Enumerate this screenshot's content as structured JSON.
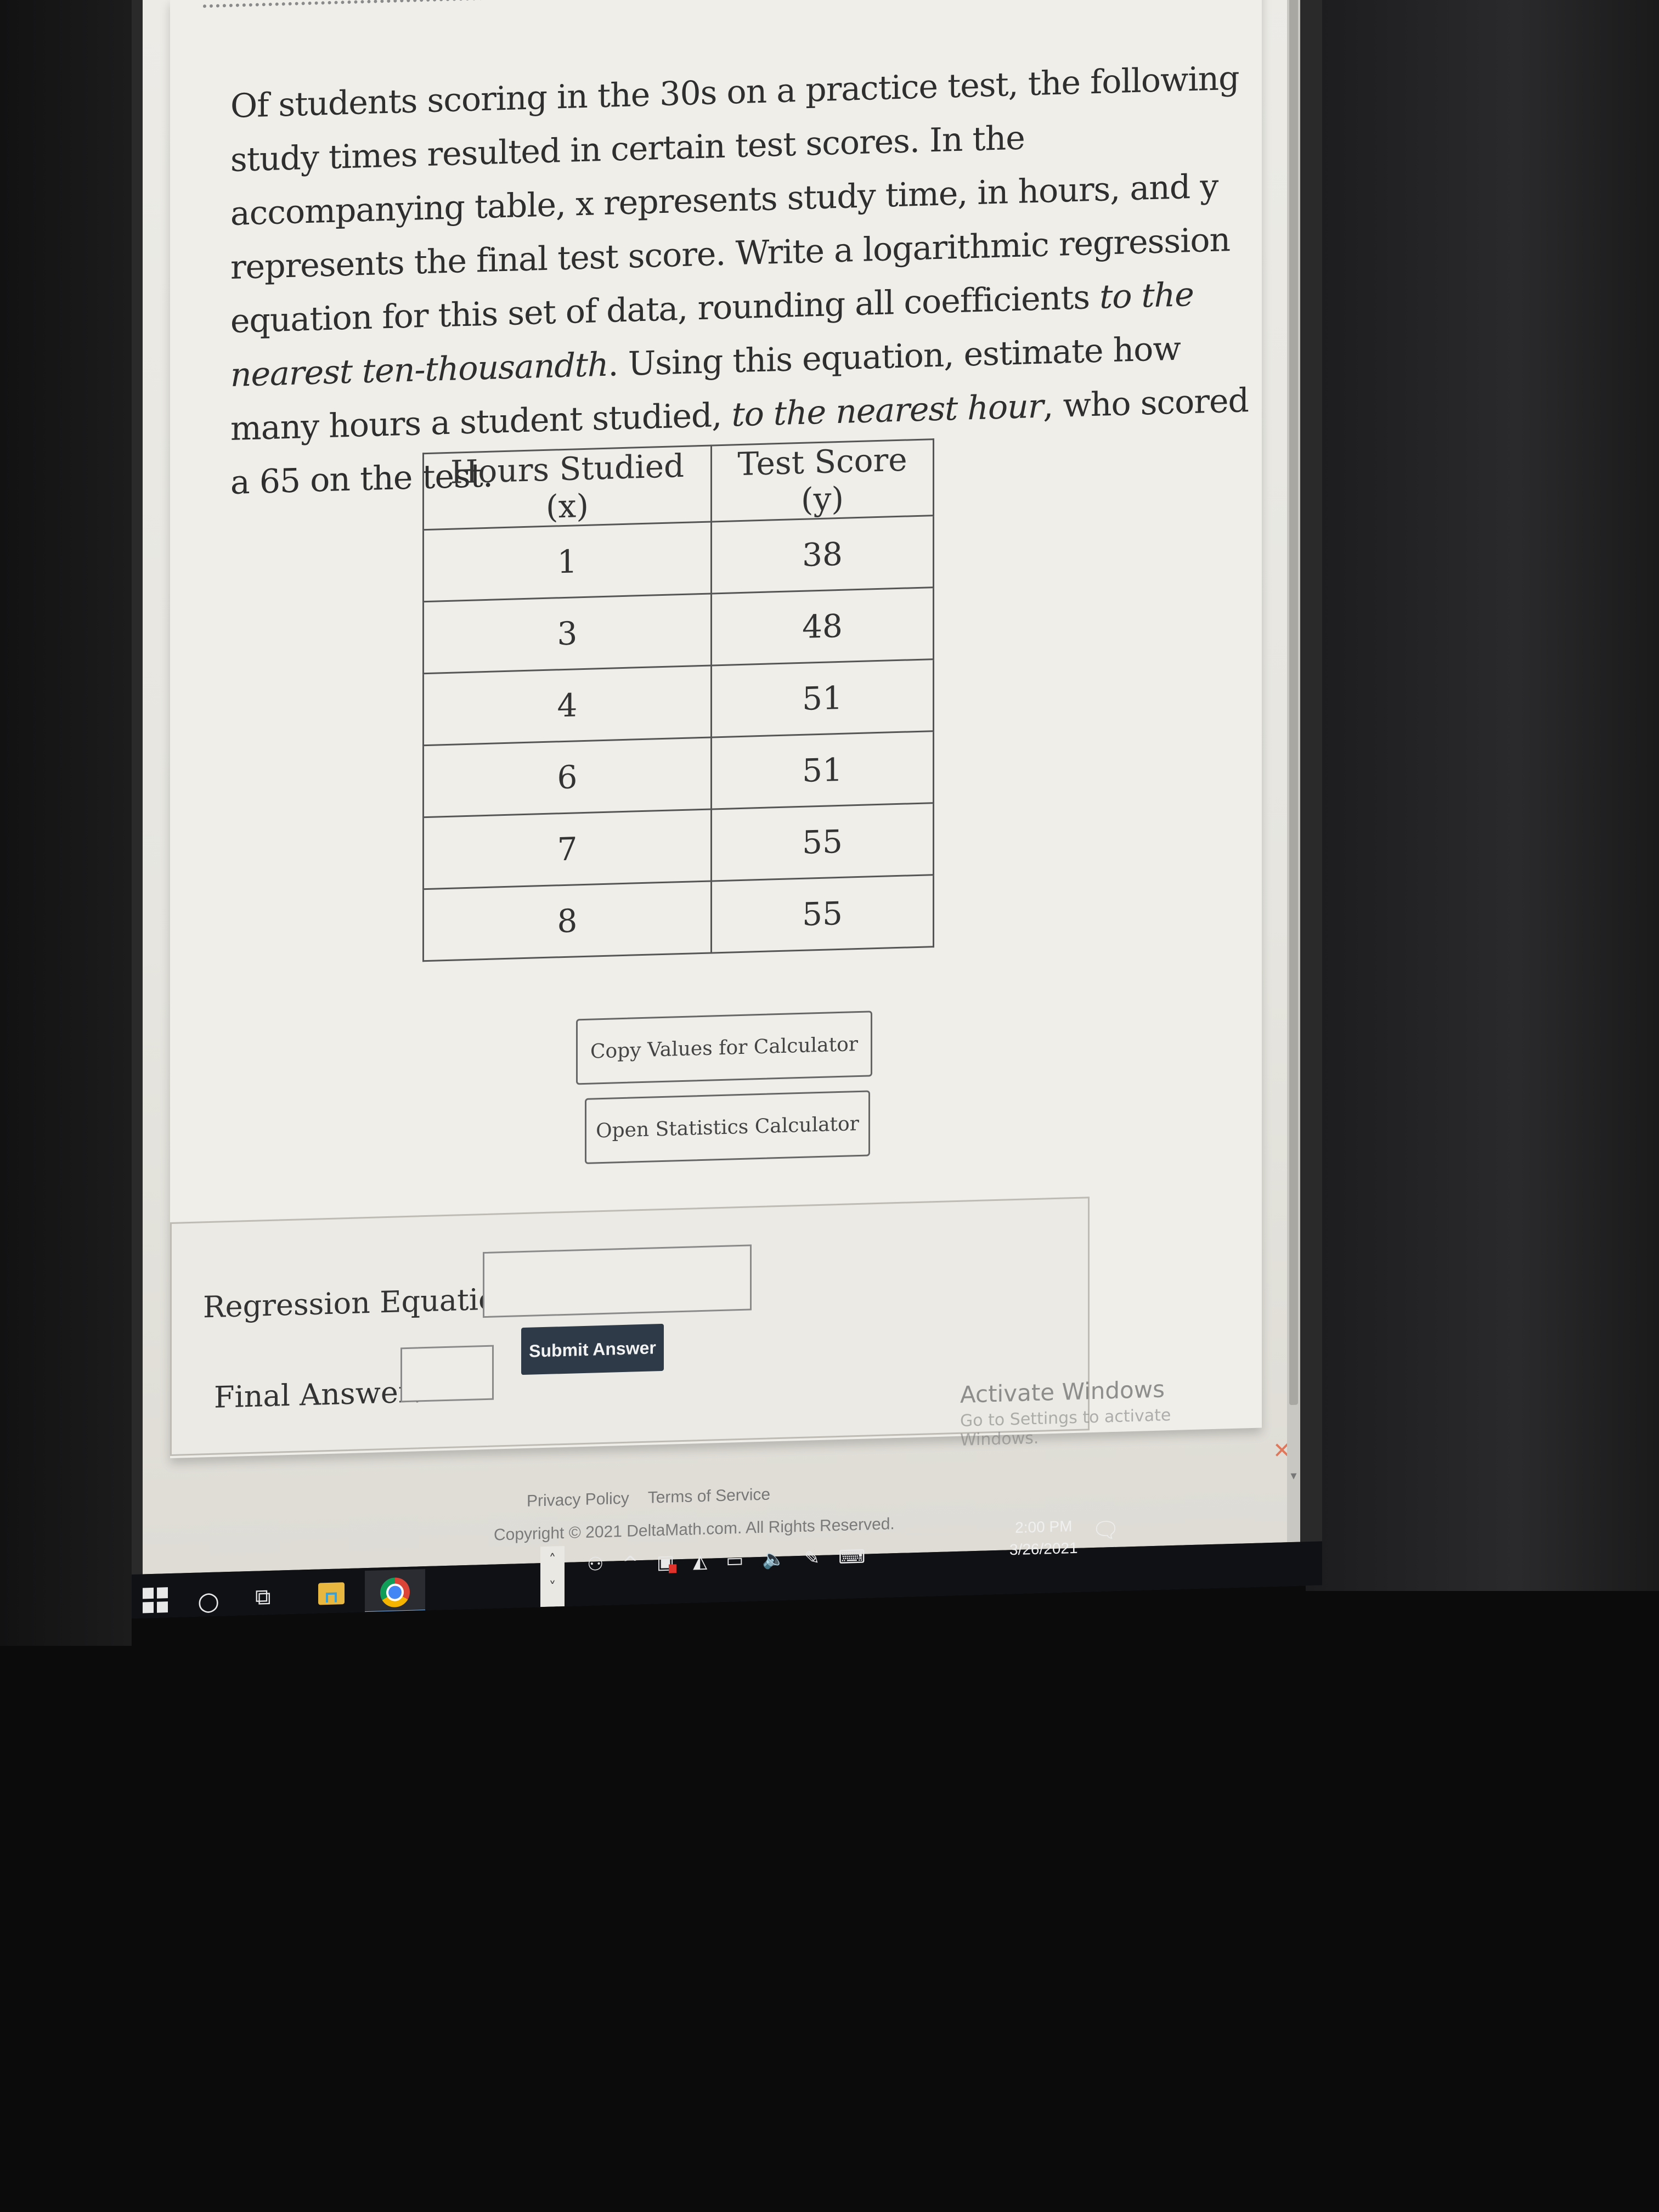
{
  "question": {
    "text_part1": "Of students scoring in the 30s on a practice test, the following study times resulted in certain test scores. In the accompanying table, x represents study time, in hours, and y represents the final test score. Write a logarithmic regression equation for this set of data, rounding all coefficients ",
    "emphasis1": "to the nearest ten-thousandth",
    "text_part2": ". Using this equation, estimate how many hours a student studied, ",
    "emphasis2": "to the nearest hour",
    "text_part3": ", who scored a 65 on the test."
  },
  "table": {
    "headers": [
      "Hours Studied (x)",
      "Test Score (y)"
    ],
    "rows": [
      [
        "1",
        "38"
      ],
      [
        "3",
        "48"
      ],
      [
        "4",
        "51"
      ],
      [
        "6",
        "51"
      ],
      [
        "7",
        "55"
      ],
      [
        "8",
        "55"
      ]
    ]
  },
  "buttons": {
    "copy_values": "Copy Values for Calculator",
    "open_calculator": "Open Statistics Calculator",
    "submit": "Submit Answer"
  },
  "answer_form": {
    "regression_label": "Regression Equation:",
    "regression_value": "",
    "final_label": "Final Answer:",
    "final_value": ""
  },
  "activation_notice": {
    "title": "Activate Windows",
    "line2": "Go to Settings to activate",
    "line3": "Windows.",
    "close_glyph": "✕"
  },
  "footer": {
    "privacy": "Privacy Policy",
    "terms": "Terms of Service",
    "copyright": "Copyright © 2021 DeltaMath.com. All Rights Reserved."
  },
  "taskbar": {
    "time": "2:00 PM",
    "date": "3/26/2021",
    "search_glyph": "○",
    "taskview_glyph": "⧉",
    "scroll_up": "˄",
    "scroll_down": "˅",
    "people_glyph": "⚇",
    "tray_up_glyph": "^",
    "security_glyph": "▣",
    "network_glyph": "◭",
    "battery_glyph": "▭",
    "volume_glyph": "🔈",
    "pen_glyph": "✎",
    "keyboard_glyph": "⌨",
    "notification_glyph": "🗨"
  }
}
